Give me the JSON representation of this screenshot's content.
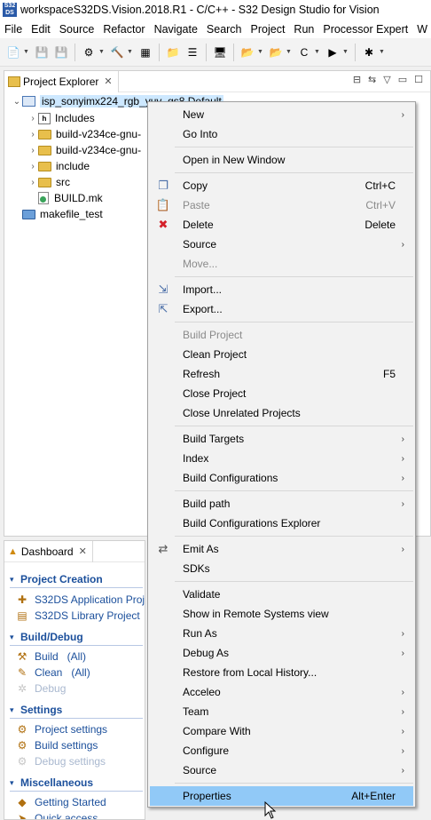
{
  "window": {
    "title": "workspaceS32DS.Vision.2018.R1 - C/C++ - S32 Design Studio for Vision",
    "app_icon_text": "S32 DS"
  },
  "menubar": [
    "File",
    "Edit",
    "Source",
    "Refactor",
    "Navigate",
    "Search",
    "Project",
    "Run",
    "Processor Expert",
    "W"
  ],
  "project_explorer": {
    "tab_label": "Project Explorer",
    "tree": [
      {
        "label": "isp_sonyimx224_rgb_yuv_gs8 Default",
        "level": 0,
        "expanded": true,
        "kind": "project",
        "selected": true
      },
      {
        "label": "Includes",
        "level": 1,
        "kind": "includes"
      },
      {
        "label": "build-v234ce-gnu-",
        "level": 1,
        "kind": "folder"
      },
      {
        "label": "build-v234ce-gnu-",
        "level": 1,
        "kind": "folder"
      },
      {
        "label": "include",
        "level": 1,
        "kind": "folder"
      },
      {
        "label": "src",
        "level": 1,
        "kind": "folder"
      },
      {
        "label": "BUILD.mk",
        "level": 1,
        "kind": "file"
      },
      {
        "label": "makefile_test",
        "level": 0,
        "kind": "folder-blue"
      }
    ]
  },
  "dashboard": {
    "tab_label": "Dashboard",
    "sections": [
      {
        "title": "Project Creation",
        "items": [
          {
            "label": "S32DS Application Project",
            "icon": "new-app-project-icon",
            "enabled": true
          },
          {
            "label": "S32DS Library Project",
            "icon": "new-library-project-icon",
            "enabled": true
          }
        ]
      },
      {
        "title": "Build/Debug",
        "items": [
          {
            "label": "Build   (All)",
            "icon": "hammer-icon",
            "enabled": true
          },
          {
            "label": "Clean   (All)",
            "icon": "broom-icon",
            "enabled": true
          },
          {
            "label": "Debug",
            "icon": "bug-icon",
            "enabled": false
          }
        ]
      },
      {
        "title": "Settings",
        "items": [
          {
            "label": "Project settings",
            "icon": "settings-icon",
            "enabled": true
          },
          {
            "label": "Build settings",
            "icon": "settings-icon",
            "enabled": true
          },
          {
            "label": "Debug settings",
            "icon": "settings-icon",
            "enabled": false
          }
        ]
      },
      {
        "title": "Miscellaneous",
        "items": [
          {
            "label": "Getting Started",
            "icon": "getting-started-icon",
            "enabled": true
          },
          {
            "label": "Quick access",
            "icon": "quick-access-icon",
            "enabled": true
          }
        ]
      }
    ]
  },
  "context_menu": {
    "items": [
      {
        "label": "New",
        "submenu": true
      },
      {
        "label": "Go Into"
      },
      {
        "sep": true
      },
      {
        "label": "Open in New Window"
      },
      {
        "sep": true
      },
      {
        "label": "Copy",
        "shortcut": "Ctrl+C",
        "icon": "copy-icon"
      },
      {
        "label": "Paste",
        "shortcut": "Ctrl+V",
        "icon": "paste-icon",
        "disabled": true
      },
      {
        "label": "Delete",
        "shortcut": "Delete",
        "icon": "delete-icon"
      },
      {
        "label": "Source",
        "submenu": true
      },
      {
        "label": "Move...",
        "disabled": true
      },
      {
        "sep": true
      },
      {
        "label": "Import...",
        "icon": "import-icon"
      },
      {
        "label": "Export...",
        "icon": "export-icon"
      },
      {
        "sep": true
      },
      {
        "label": "Build Project",
        "disabled": true
      },
      {
        "label": "Clean Project"
      },
      {
        "label": "Refresh",
        "shortcut": "F5"
      },
      {
        "label": "Close Project"
      },
      {
        "label": "Close Unrelated Projects"
      },
      {
        "sep": true
      },
      {
        "label": "Build Targets",
        "submenu": true
      },
      {
        "label": "Index",
        "submenu": true
      },
      {
        "label": "Build Configurations",
        "submenu": true
      },
      {
        "sep": true
      },
      {
        "label": "Build path",
        "submenu": true
      },
      {
        "label": "Build Configurations Explorer"
      },
      {
        "sep": true
      },
      {
        "label": "Emit As",
        "submenu": true,
        "icon": "emit-as-icon"
      },
      {
        "label": "SDKs"
      },
      {
        "sep": true
      },
      {
        "label": "Validate"
      },
      {
        "label": "Show in Remote Systems view"
      },
      {
        "label": "Run As",
        "submenu": true
      },
      {
        "label": "Debug As",
        "submenu": true
      },
      {
        "label": "Restore from Local History..."
      },
      {
        "label": "Acceleo",
        "submenu": true
      },
      {
        "label": "Team",
        "submenu": true
      },
      {
        "label": "Compare With",
        "submenu": true
      },
      {
        "label": "Configure",
        "submenu": true
      },
      {
        "label": "Source",
        "submenu": true
      },
      {
        "sep": true
      },
      {
        "label": "Properties",
        "shortcut": "Alt+Enter",
        "highlighted": true
      }
    ]
  }
}
